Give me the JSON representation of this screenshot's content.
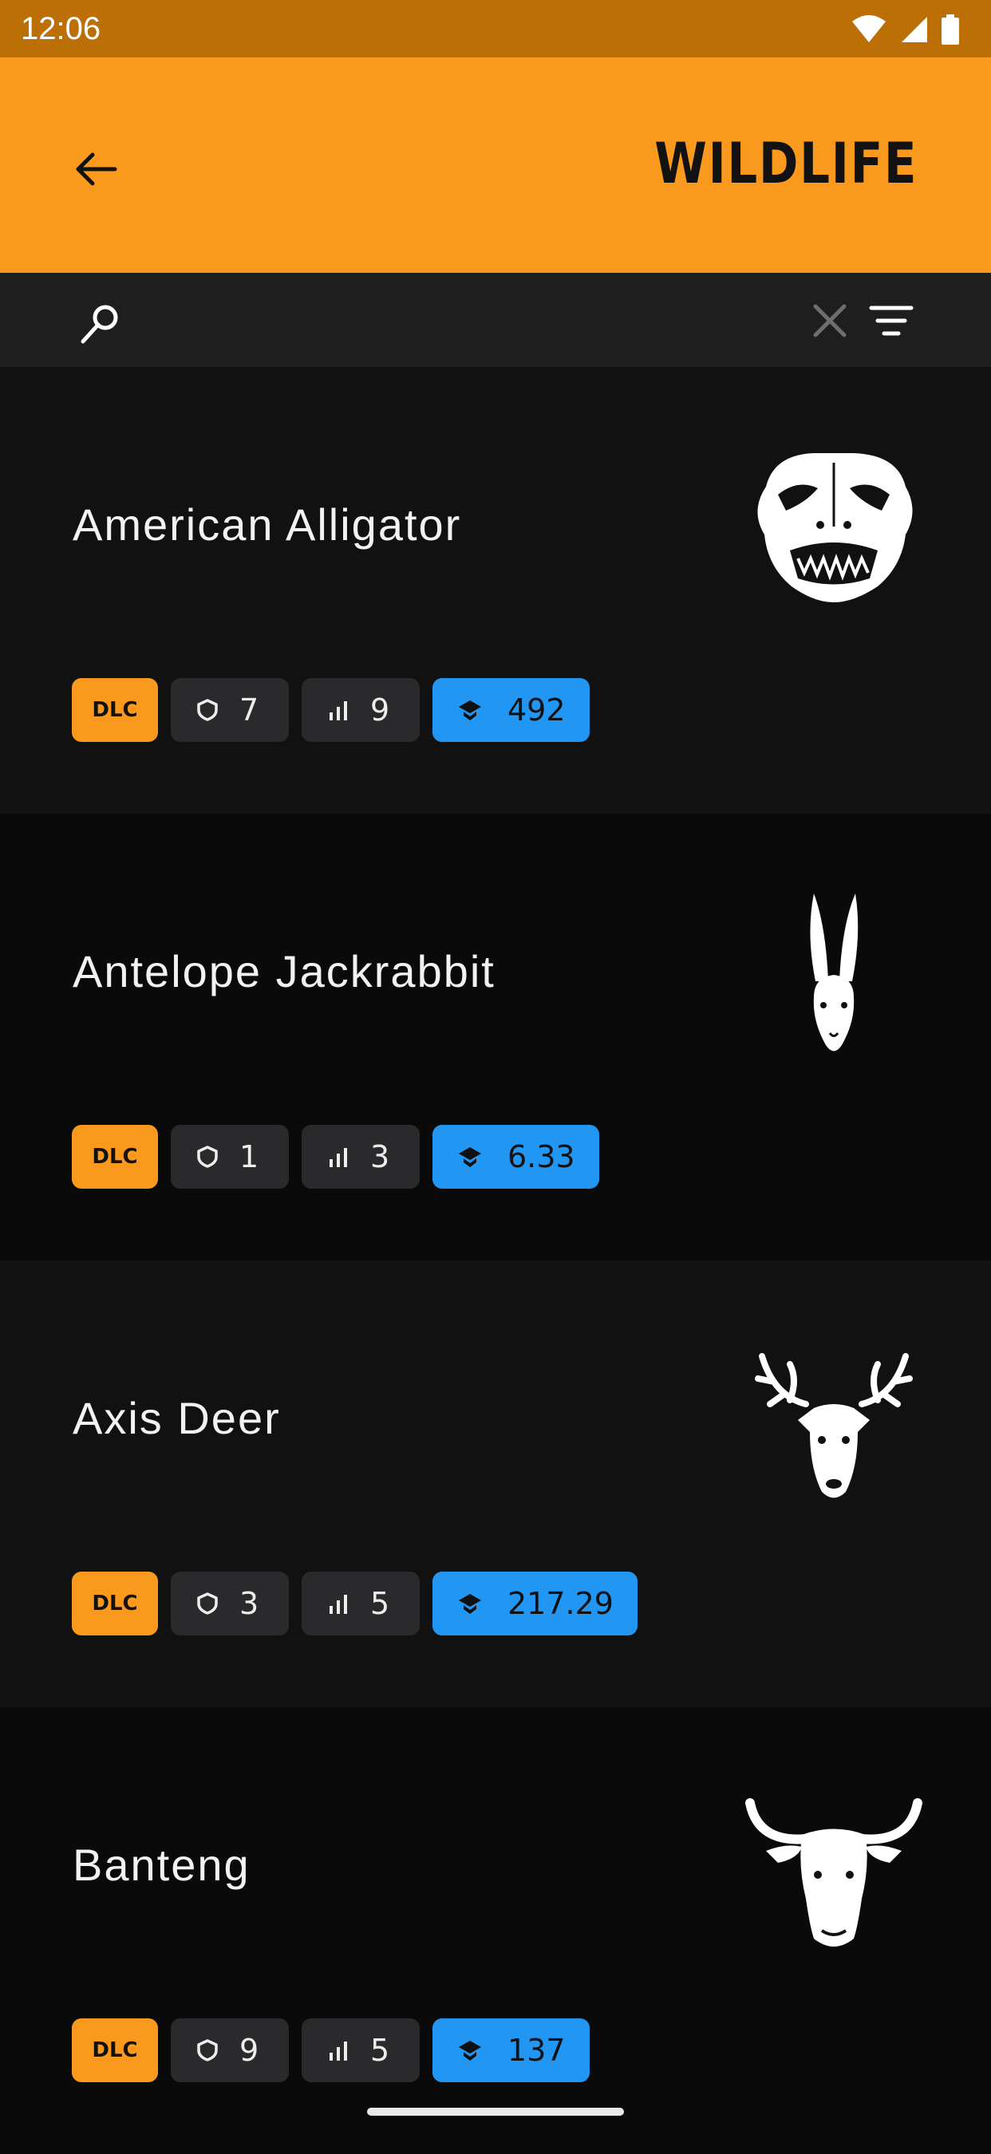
{
  "status_bar": {
    "time": "12:06"
  },
  "app_bar": {
    "title": "WILDLIFE"
  },
  "search": {
    "placeholder": "",
    "value": ""
  },
  "colors": {
    "accent": "#F99A1F",
    "status": "#BD6F07",
    "blue": "#2196F3"
  },
  "animals": [
    {
      "name": "American Alligator",
      "dlc": "DLC",
      "class": "7",
      "difficulty": "9",
      "score": "492",
      "icon": "alligator-icon"
    },
    {
      "name": "Antelope Jackrabbit",
      "dlc": "DLC",
      "class": "1",
      "difficulty": "3",
      "score": "6.33",
      "icon": "jackrabbit-icon"
    },
    {
      "name": "Axis Deer",
      "dlc": "DLC",
      "class": "3",
      "difficulty": "5",
      "score": "217.29",
      "icon": "deer-icon"
    },
    {
      "name": "Banteng",
      "dlc": "DLC",
      "class": "9",
      "difficulty": "5",
      "score": "137",
      "icon": "banteng-icon"
    }
  ]
}
